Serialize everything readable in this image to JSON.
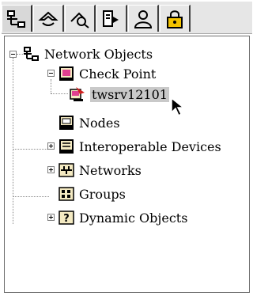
{
  "toolbar": {
    "tabs": [
      {
        "icon": "network-objects-icon",
        "active": true
      },
      {
        "icon": "services-icon",
        "active": false
      },
      {
        "icon": "resources-icon",
        "active": false
      },
      {
        "icon": "servers-icon",
        "active": false
      },
      {
        "icon": "users-icon",
        "active": false
      },
      {
        "icon": "lock-icon",
        "active": false
      }
    ]
  },
  "tree": {
    "root": {
      "label": "Network Objects",
      "expanded": true
    },
    "check_point": {
      "label": "Check Point",
      "expanded": true
    },
    "gateway": {
      "label": "twsrv12101",
      "selected": true
    },
    "nodes": {
      "label": "Nodes"
    },
    "interop": {
      "label": "Interoperable Devices",
      "expanded": false
    },
    "networks": {
      "label": "Networks",
      "expanded": false
    },
    "groups": {
      "label": "Groups"
    },
    "dynamic": {
      "label": "Dynamic Objects",
      "expanded": false
    }
  },
  "colors": {
    "toolbar_bg": "#e6e6e6",
    "selection_bg": "#c9c9c9",
    "lock_yellow": "#f2c200"
  }
}
